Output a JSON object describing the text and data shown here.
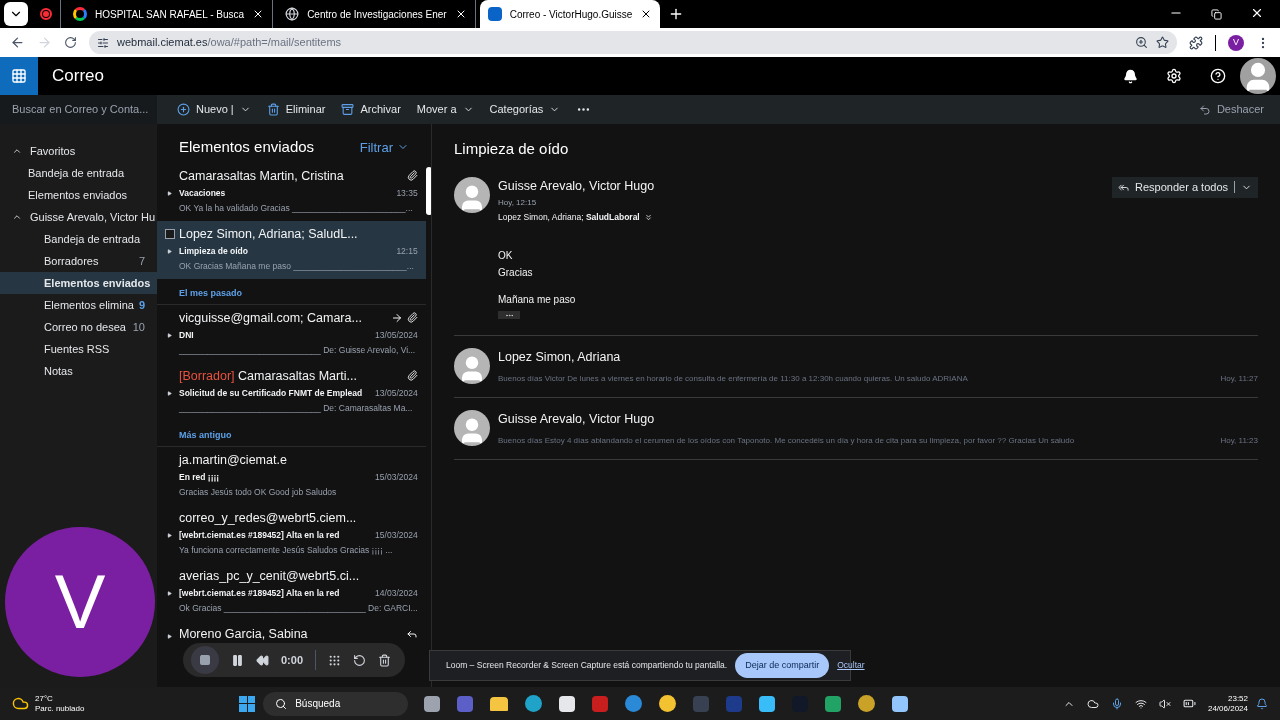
{
  "browser": {
    "tabs": [
      {
        "kind": "recording",
        "selected": false
      },
      {
        "kind": "google",
        "title": "HOSPITAL SAN RAFAEL - Busca",
        "selected": false
      },
      {
        "kind": "globe",
        "title": "Centro de Investigaciones Ener",
        "selected": false
      },
      {
        "kind": "outlook",
        "title": "Correo - VictorHugo.Guisse",
        "selected": true
      }
    ],
    "url_host": "webmail.ciemat.es",
    "url_path": "/owa/#path=/mail/sentitems",
    "profile": "V"
  },
  "app": {
    "title": "Correo",
    "search_placeholder": "Buscar en Correo y Conta...",
    "toolbar": [
      {
        "kind": "new",
        "label": "Nuevo |"
      },
      {
        "kind": "delete",
        "label": "Eliminar"
      },
      {
        "kind": "archive",
        "label": "Archivar"
      },
      {
        "kind": "menu",
        "label": "Mover a"
      },
      {
        "kind": "menu",
        "label": "Categorías"
      },
      {
        "kind": "more"
      }
    ],
    "undo": "Deshacer"
  },
  "folders": [
    {
      "label": "Favoritos",
      "expanded": true,
      "children": [
        {
          "label": "Bandeja de entrada",
          "selected": false
        },
        {
          "label": "Elementos enviados",
          "selected": false
        }
      ]
    },
    {
      "label": "Guisse Arevalo, Victor Hu",
      "expanded": true,
      "children": [
        {
          "label": "Bandeja de entrada",
          "selected": false
        },
        {
          "label": "Borradores",
          "count": "7",
          "unread": false,
          "selected": false
        },
        {
          "label": "Elementos enviados",
          "selected": true
        },
        {
          "label": "Elementos elimina",
          "count": "9",
          "unread": true,
          "selected": false
        },
        {
          "label": "Correo no desea",
          "count": "10",
          "unread": false,
          "selected": false
        },
        {
          "label": "Fuentes RSS",
          "selected": false
        },
        {
          "label": "Notas",
          "selected": false
        }
      ]
    }
  ],
  "list": {
    "title": "Elementos enviados",
    "filter": "Filtrar",
    "items": [
      {
        "kind": "message",
        "sender": "Camarasaltas Martin, Cristina",
        "subject": "Vacaciones",
        "date": "13:35",
        "preview": "OK Ya la ha validado Gracias ________________________...",
        "attachment": true,
        "forwarded": false,
        "replied": false,
        "expandable": true,
        "selected": false
      },
      {
        "kind": "message",
        "sender": "Lopez Simon, Adriana; SaludL...",
        "subject": "Limpieza de oído",
        "date": "12:15",
        "preview": "OK Gracias Mañana me paso ________________________...",
        "attachment": false,
        "forwarded": false,
        "replied": false,
        "expandable": true,
        "selected": true
      },
      {
        "kind": "group",
        "label": "El mes pasado"
      },
      {
        "kind": "message",
        "sender": "vicguisse@gmail.com; Camara...",
        "subject": "DNI",
        "date": "13/05/2024",
        "preview": "______________________________ De: Guisse Arevalo, Vi...",
        "attachment": true,
        "forwarded": true,
        "replied": false,
        "expandable": true,
        "selected": false
      },
      {
        "kind": "message",
        "draft_tag": "[Borrador]",
        "sender": "Camarasaltas Marti...",
        "subject": "Solicitud de su Certificado FNMT de Emplead",
        "date": "13/05/2024",
        "preview": "______________________________ De: Camarasaltas Ma...",
        "attachment": true,
        "forwarded": false,
        "replied": false,
        "expandable": true,
        "selected": false
      },
      {
        "kind": "group",
        "label": "Más antiguo"
      },
      {
        "kind": "message",
        "sender": "ja.martin@ciemat.e",
        "subject": "En red ¡¡¡¡",
        "date": "15/03/2024",
        "preview": "Gracias Jesús todo OK Good job Saludos",
        "attachment": false,
        "forwarded": false,
        "replied": false,
        "expandable": false,
        "selected": false
      },
      {
        "kind": "message",
        "sender": "correo_y_redes@webrt5.ciem...",
        "subject": "[webrt.ciemat.es #189452] Alta en la red",
        "date": "15/03/2024",
        "preview": "Ya funciona correctamente Jesús Saludos Gracias ¡¡¡¡ ...",
        "attachment": false,
        "forwarded": false,
        "replied": false,
        "expandable": true,
        "selected": false
      },
      {
        "kind": "message",
        "sender": "averias_pc_y_cenit@webrt5.ci...",
        "subject": "[webrt.ciemat.es #189452] Alta en la red",
        "date": "14/03/2024",
        "preview": "Ok Gracias ______________________________ De: GARCI...",
        "attachment": false,
        "forwarded": false,
        "replied": false,
        "expandable": true,
        "selected": false
      },
      {
        "kind": "message",
        "sender": "Moreno Garcia, Sabina",
        "attachment": false,
        "forwarded": false,
        "replied": true,
        "expandable": true,
        "selected": false
      }
    ]
  },
  "reading": {
    "subject": "Limpieza de oído",
    "reply_all": "Responder a todos",
    "thread": [
      {
        "expanded": true,
        "sender": "Guisse Arevalo, Victor Hugo",
        "time": "Hoy, 12:15",
        "recipients": "Lopez Simon, Adriana; **SaludLaboral**",
        "body": [
          [
            "OK",
            "Gracias"
          ],
          [
            "Mañana me paso"
          ]
        ]
      },
      {
        "expanded": false,
        "sender": "Lopez Simon, Adriana",
        "preview": "Buenos días Victor De lunes a viernes en horario de consulta de enfermería de 11:30 a 12:30h cuando quieras. Un saludo ADRIANA",
        "time": "Hoy, 11:27"
      },
      {
        "expanded": false,
        "sender": "Guisse Arevalo, Victor Hugo",
        "preview": "Buenos días Estoy 4 días ablandando el cerumen de los oídos con Taponoto. Me concedéis un día y hora de cita para su limpieza, por favor ?? Gracias Un saludo",
        "time": "Hoy, 11:23"
      }
    ]
  },
  "loom": {
    "camera_letter": "V",
    "timer": "0:00",
    "banner": "Loom – Screen Recorder & Screen Capture está compartiendo tu pantalla.",
    "stop_sharing": "Dejar de compartir",
    "hide": "Ocultar"
  },
  "taskbar": {
    "temperature": "27°C",
    "weather": "Parc. nublado",
    "search": "Búsqueda",
    "apps": [
      {
        "kind": "files",
        "color": "#9ca3af"
      },
      {
        "kind": "teams",
        "color": "#5b5fc7"
      },
      {
        "kind": "folder",
        "color": "#f5c542"
      },
      {
        "kind": "edge",
        "color": "#1fa3c9"
      },
      {
        "kind": "store",
        "color": "#e5e7eb"
      },
      {
        "kind": "shield",
        "color": "#c81e1e"
      },
      {
        "kind": "help",
        "color": "#2b8ad8"
      },
      {
        "kind": "chrome",
        "color": "#f2c230"
      },
      {
        "kind": "terminal",
        "color": "#374151"
      },
      {
        "kind": "qb",
        "color": "#1e3a8a"
      },
      {
        "kind": "notepad",
        "color": "#38bdf8"
      },
      {
        "kind": "x",
        "color": "#111827"
      },
      {
        "kind": "excel",
        "color": "#21a366"
      },
      {
        "kind": "ue",
        "color": "#c9a227"
      },
      {
        "kind": "misc",
        "color": "#93c5fd"
      }
    ],
    "time": "23:52",
    "date": "24/06/2024"
  }
}
